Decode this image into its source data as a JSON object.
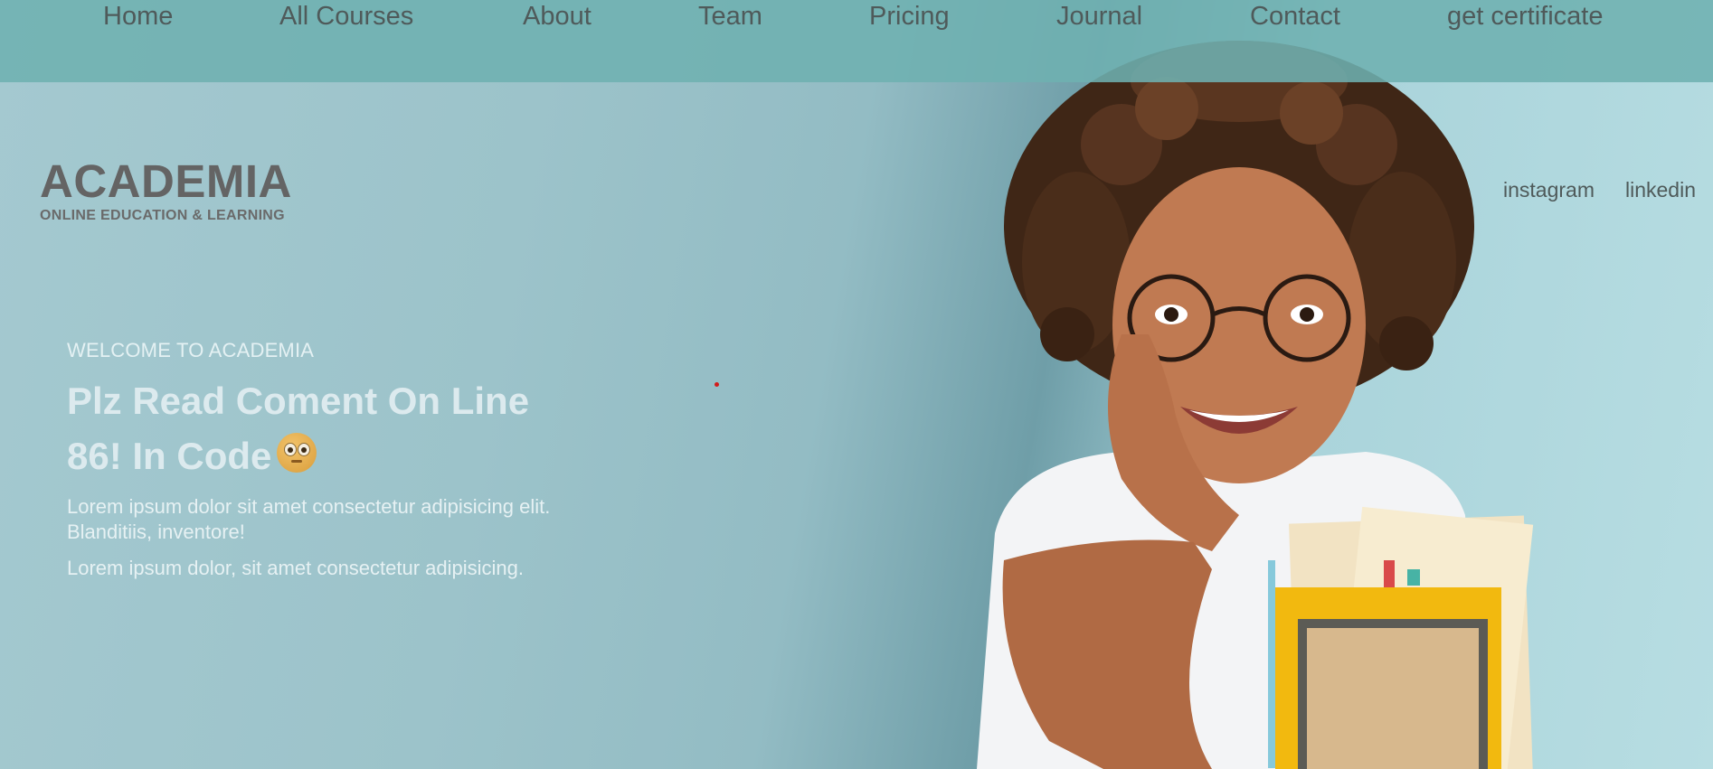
{
  "nav": {
    "items": [
      {
        "label": "Home"
      },
      {
        "label": "All Courses"
      },
      {
        "label": "About"
      },
      {
        "label": "Team"
      },
      {
        "label": "Pricing"
      },
      {
        "label": "Journal"
      },
      {
        "label": "Contact"
      },
      {
        "label": "get certificate"
      }
    ]
  },
  "brand": {
    "title": "ACADEMIA",
    "subtitle": "ONLINE EDUCATION & LEARNING"
  },
  "social": {
    "instagram": "instagram",
    "linkedin": "linkedin"
  },
  "hero": {
    "eyebrow": "WELCOME TO ACADEMIA",
    "title": "Plz Read Coment On Line 86! In Code",
    "paragraph1": "Lorem ipsum dolor sit amet consectetur adipisicing elit. Blanditiis, inventore!",
    "paragraph2": "Lorem ipsum dolor, sit amet consectetur adipisicing."
  },
  "icons": {
    "hero_emoji": "rolling-eyes-emoji-icon"
  },
  "colors": {
    "nav_bg": "#6eb0b0",
    "nav_text": "#4f5a5a",
    "brand_text": "#646464",
    "hero_text": "#dceaee",
    "background": "#9cc3ca"
  }
}
